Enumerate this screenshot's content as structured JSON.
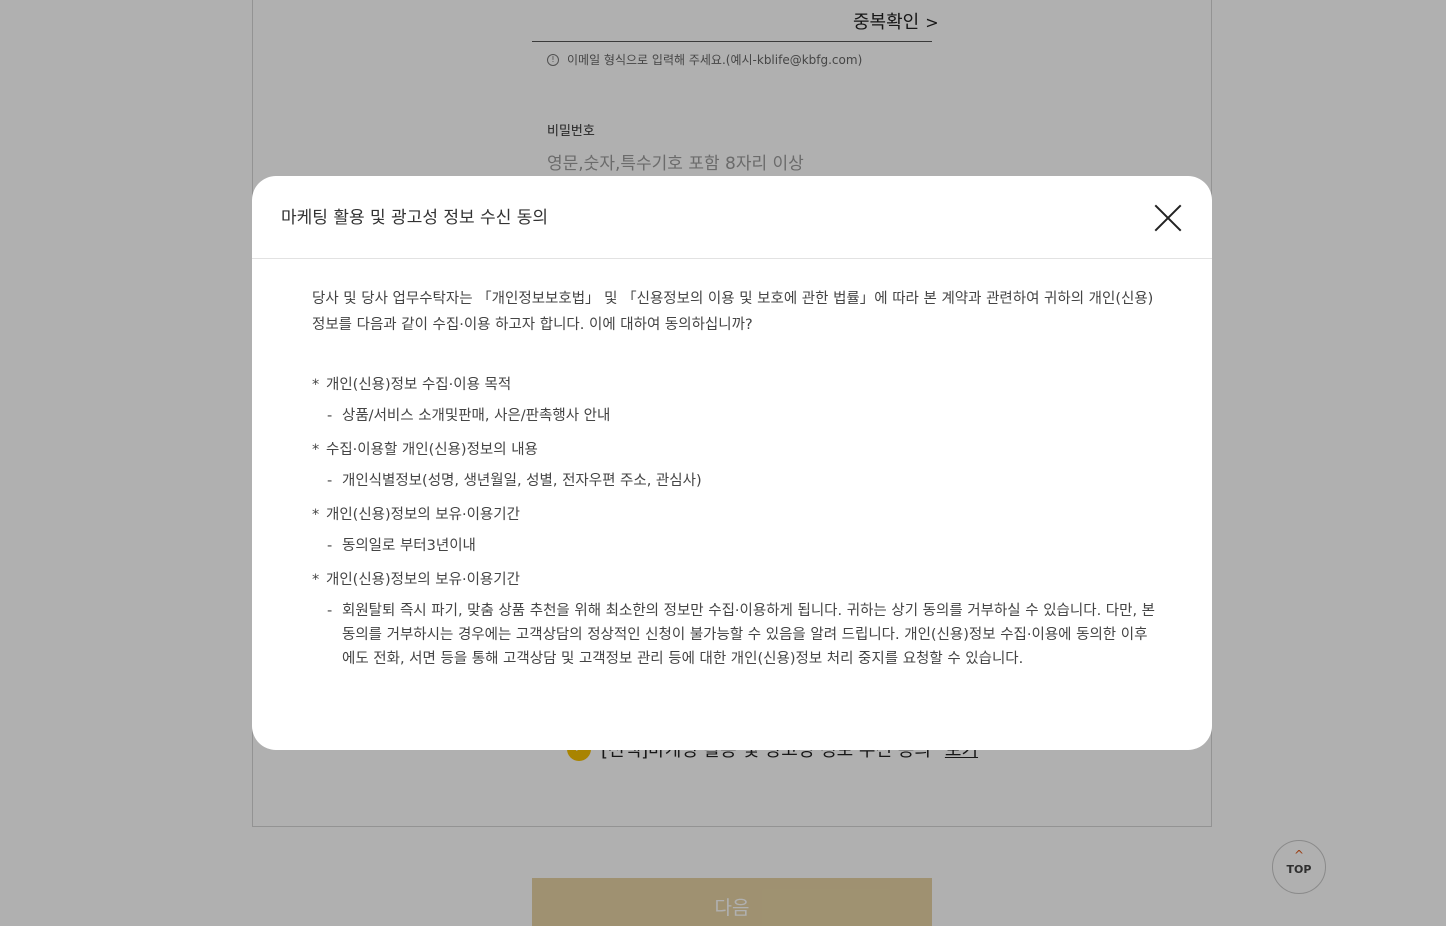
{
  "background": {
    "dup_check_label": "중복확인",
    "dup_check_chevron": ">",
    "email_hint": "이메일 형식으로 입력해 주세요.(예시-kblife@kbfg.com)",
    "password_label": "비밀번호",
    "password_placeholder": "영문,숫자,특수기호 포함 8자리 이상",
    "consent_text": "[선택]마케팅 활용 및 광고성 정보 수신 동의",
    "consent_view_link": "보기",
    "next_button": "다음",
    "top_button": "TOP"
  },
  "modal": {
    "title": "마케팅 활용 및 광고성 정보 수신 동의",
    "intro": "당사 및 당사 업무수탁자는 「개인정보보호법」 및 「신용정보의 이용 및 보호에 관한 법률」에 따라 본 계약과 관련하여 귀하의 개인(신용)정보를 다음과 같이 수집·이용 하고자 합니다. 이에 대하여 동의하십니까?",
    "sections": [
      {
        "heading": "개인(신용)정보 수집·이용 목적",
        "detail": "상품/서비스 소개및판매, 사은/판촉행사 안내"
      },
      {
        "heading": "수집·이용할 개인(신용)정보의 내용",
        "detail": "개인식별정보(성명, 생년월일, 성별, 전자우편 주소, 관심사)"
      },
      {
        "heading": "개인(신용)정보의 보유·이용기간",
        "detail": "동의일로 부터3년이내"
      },
      {
        "heading": "개인(신용)정보의 보유·이용기간",
        "detail": "회원탈퇴 즉시 파기, 맞춤 상품 추천을 위해 최소한의 정보만 수집·이용하게 됩니다. 귀하는 상기 동의를 거부하실 수 있습니다. 다만, 본 동의를 거부하시는 경우에는 고객상담의 정상적인 신청이 불가능할 수 있음을 알려 드립니다. 개인(신용)정보 수집·이용에 동의한 이후에도 전화, 서면 등을 통해 고객상담 및 고객정보 관리 등에 대한 개인(신용)정보 처리 중지를 요청할 수 있습니다."
      }
    ],
    "bullet_marker": "*",
    "detail_marker": "-"
  },
  "colors": {
    "overlay": "#000000",
    "next_button": "#e7d3a4",
    "check_circle": "#f5c000",
    "top_arrow": "#e05a1b"
  },
  "icons": {
    "close": "close-icon",
    "info": "info-icon",
    "check": "check-icon",
    "top_arrow": "chevron-up-icon"
  }
}
